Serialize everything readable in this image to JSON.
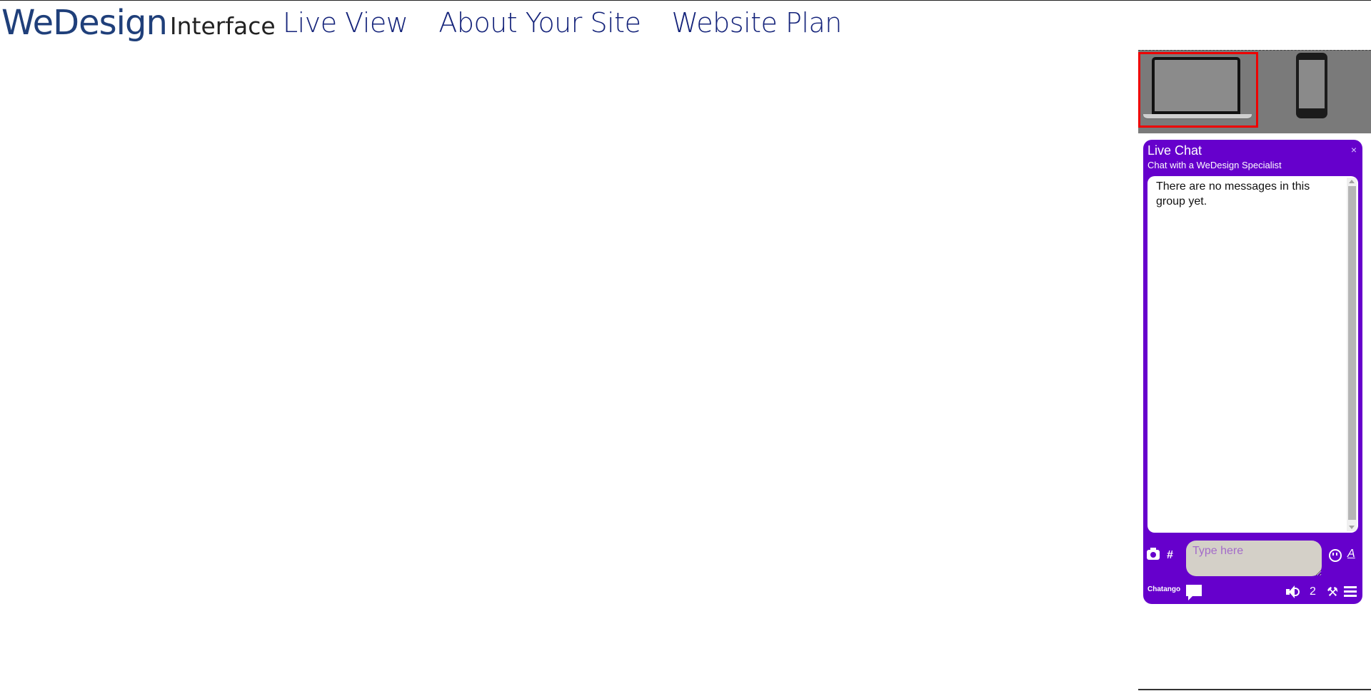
{
  "brand": {
    "logo_main": "WeDesign",
    "logo_sub": "Interface"
  },
  "nav": {
    "items": [
      "Live View",
      "About Your Site",
      "Website Plan"
    ]
  },
  "devices": {
    "options": [
      "laptop-icon",
      "phone-icon"
    ],
    "selected": "laptop",
    "selected_color": "#ee0000"
  },
  "chat": {
    "title": "Live Chat",
    "subtitle": "Chat with a WeDesign Specialist",
    "close_label": "×",
    "empty_message": "There are no messages in this group yet.",
    "input_placeholder": "Type here",
    "hash_label": "#",
    "format_label": "A",
    "footer_brand": "Chatango",
    "user_count": "2",
    "accent_color": "#6600cc"
  }
}
